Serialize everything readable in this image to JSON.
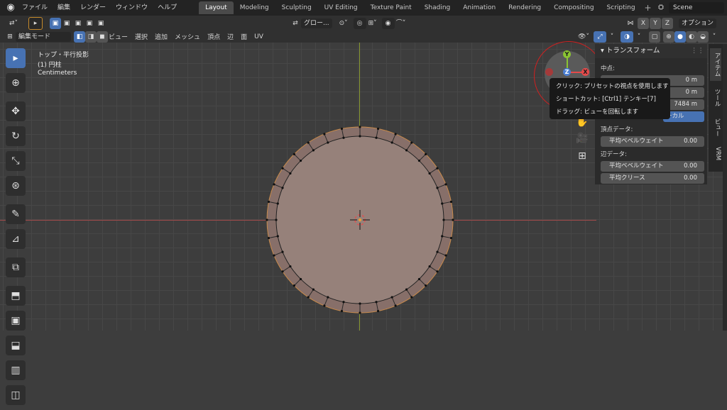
{
  "topbar": {
    "logo_icon": "blender-icon",
    "menus": [
      "ファイル",
      "編集",
      "レンダー",
      "ウィンドウ",
      "ヘルプ"
    ],
    "workspaces": [
      "Layout",
      "Modeling",
      "Sculpting",
      "UV Editing",
      "Texture Paint",
      "Shading",
      "Animation",
      "Rendering",
      "Compositing",
      "Scripting"
    ],
    "active_workspace": "Layout",
    "add_tab": "+",
    "scene": "Scene"
  },
  "header": {
    "transform_pivot": "グロー...",
    "axes": [
      "X",
      "Y",
      "Z"
    ],
    "options": "オプション"
  },
  "header2": {
    "mode": "編集モード",
    "menus": [
      "ビュー",
      "選択",
      "追加",
      "メッシュ",
      "頂点",
      "辺",
      "面",
      "UV"
    ]
  },
  "viewport_overlay": {
    "view_name": "トップ・平行投影",
    "object": "(1) 円柱",
    "units": "Centimeters"
  },
  "gizmo": {
    "y": "Y",
    "z": "Z",
    "x": "X"
  },
  "tooltip": {
    "line1": "クリック: プリセットの視点を使用します",
    "line2": "ショートカット: [Ctrl1] テンキー[7]",
    "line3": "ドラッグ: ビューを回転します"
  },
  "npanel": {
    "title": "トランスフォーム",
    "median_label": "中点:",
    "x_value": "0 m",
    "y_value": "0 m",
    "z_value": "7484 m",
    "local_btn": "ーカル",
    "vertex_data_label": "頂点データ:",
    "vertex_bevel_weight": "平均ベベルウェイト",
    "vertex_bevel_value": "0.00",
    "edge_data_label": "辺データ:",
    "edge_bevel_weight": "平均ベベルウェイト",
    "edge_bevel_value": "0.00",
    "edge_crease": "平均クリース",
    "edge_crease_value": "0.00",
    "tabs": [
      "アイテム",
      "ツール",
      "ビュー",
      "VRM"
    ]
  },
  "colors": {
    "active_blue": "#4772b3",
    "mesh_fill": "#96817a",
    "x_axis": "#a04a4a",
    "y_axis": "#8a9a33",
    "annotation_red": "#d02020"
  }
}
